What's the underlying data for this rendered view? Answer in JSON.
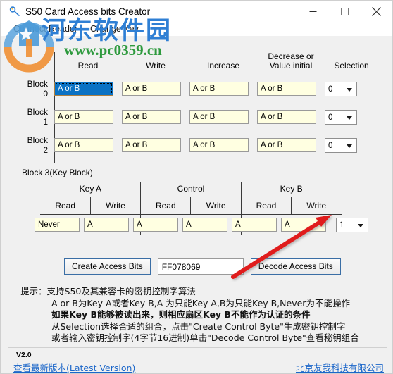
{
  "window": {
    "title": "S50 Card Access bits Creator",
    "app_icon": "key-icon",
    "minimize": "minimize-icon",
    "maximize": "maximize-icon",
    "close": "close-icon"
  },
  "menu": {
    "items": [
      {
        "label": "Connect Reader"
      },
      {
        "label": "Change Key"
      }
    ]
  },
  "watermark": {
    "cn": "河东软件园",
    "url": "www.pc0359.cn"
  },
  "grid": {
    "headers": [
      "Read",
      "Write",
      "Increase",
      "Decrease or\nValue initial",
      "Selection"
    ],
    "header_decrease_line1": "Decrease or",
    "header_decrease_line2": "Value initial",
    "rows": [
      {
        "label": "Block 0",
        "read": "A or  B",
        "write": "A or  B",
        "increase": "A or  B",
        "decrease": "A or  B",
        "selection": "0",
        "read_selected": true
      },
      {
        "label": "Block 1",
        "read": "A or  B",
        "write": "A or  B",
        "increase": "A or  B",
        "decrease": "A or  B",
        "selection": "0",
        "read_selected": false
      },
      {
        "label": "Block 2",
        "read": "A or  B",
        "write": "A or  B",
        "increase": "A or  B",
        "decrease": "A or  B",
        "selection": "0",
        "read_selected": false
      }
    ]
  },
  "block3": {
    "title": "Block 3(Key Block)",
    "groups": [
      "Key A",
      "Control",
      "Key B"
    ],
    "subheaders": [
      "Read",
      "Write",
      "Read",
      "Write",
      "Read",
      "Write"
    ],
    "values": [
      "Never",
      "A",
      "A",
      "A",
      "A",
      "A"
    ],
    "selection": "1"
  },
  "actions": {
    "create_label": "Create Access Bits",
    "hex_value": "FF078069",
    "decode_label": "Decode Access Bits"
  },
  "tips": {
    "lead": "提示：",
    "line1": "支持S50及其兼容卡的密钥控制字算法",
    "line2": "A or B为Key A或者Key B,A 为只能Key A,B为只能Key B,Never为不能操作",
    "line3": "如果Key B能够被读出来，则相应扇区Key B不能作为认证的条件",
    "line4": "从Selection选择合适的组合，点击\"Create Control Byte\"生成密钥控制字",
    "line5": "或者输入密钥控制字(4字节16进制)单击\"Decode Control Byte\"查看秘钥组合"
  },
  "footer": {
    "version": "V2.0",
    "latest_link": "查看最新版本(Latest Version)",
    "company": "北京友我科技有限公司"
  },
  "annotation": {
    "arrow_color": "#e01b1b",
    "arrow_name": "red-arrow-annotation"
  }
}
